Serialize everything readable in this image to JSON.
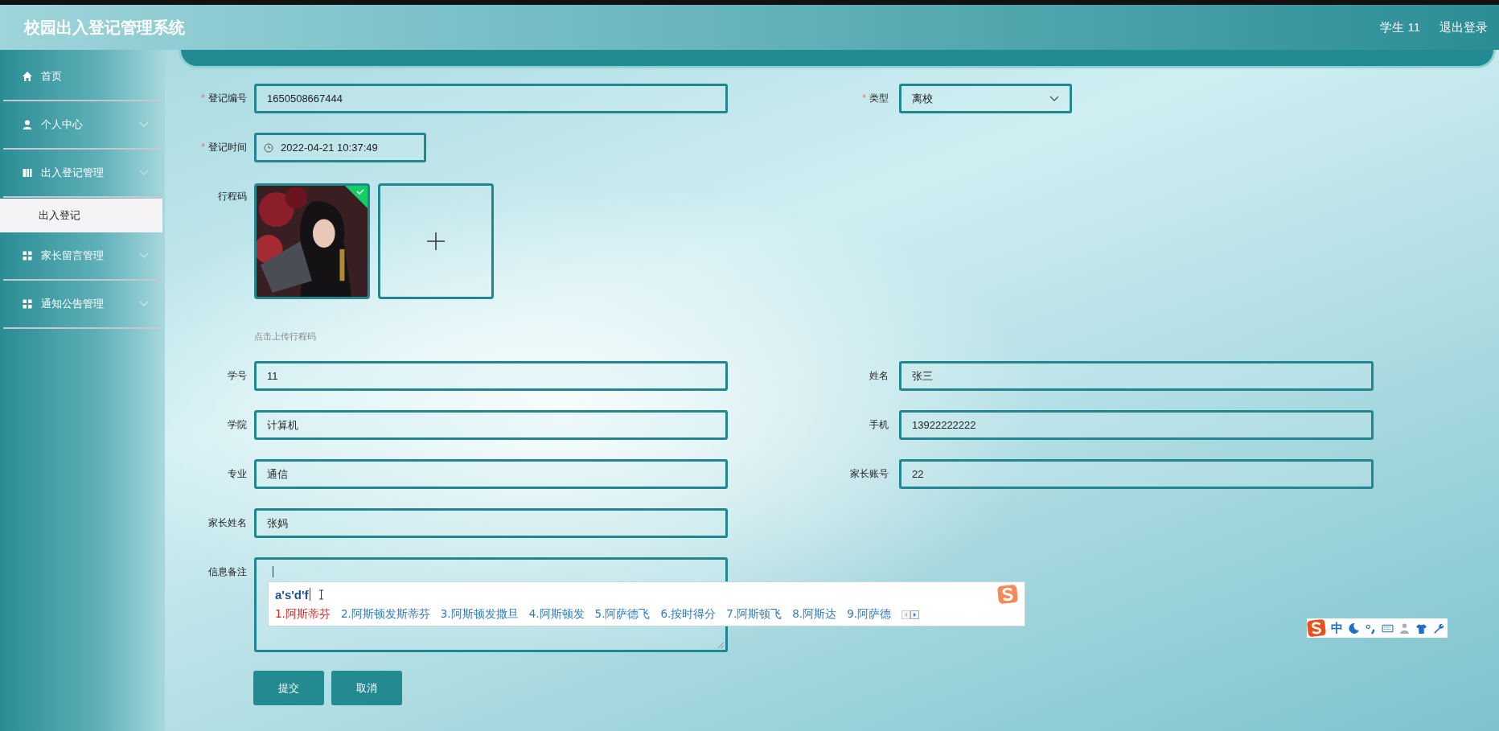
{
  "header": {
    "title": "校园出入登记管理系统",
    "user": "学生 11",
    "logout": "退出登录"
  },
  "sidebar": {
    "items": [
      {
        "label": "首页",
        "kind": "home"
      },
      {
        "label": "个人中心",
        "kind": "user",
        "expanded": false
      },
      {
        "label": "出入登记管理",
        "kind": "book",
        "expanded": true,
        "children": [
          {
            "label": "出入登记",
            "selected": true
          }
        ]
      },
      {
        "label": "家长留言管理",
        "kind": "grid",
        "expanded": false
      },
      {
        "label": "通知公告管理",
        "kind": "grid",
        "expanded": false
      }
    ]
  },
  "form": {
    "rows": [
      [
        {
          "kind": "text",
          "required_mark": "*",
          "label": "登记编号",
          "value": "1650508667444"
        },
        {
          "kind": "select",
          "required_mark": "*",
          "label": "类型",
          "value": "离校"
        }
      ],
      [
        {
          "kind": "datetime",
          "required_mark": "*",
          "label": "登记时间",
          "value": "2022-04-21 10:37:49"
        }
      ],
      [
        {
          "kind": "upload",
          "label": "行程码",
          "uploaded": true,
          "hint": "点击上传行程码"
        }
      ],
      [
        {
          "kind": "text",
          "label": "学号",
          "value": "11"
        },
        {
          "kind": "text",
          "label": "姓名",
          "value": "张三"
        }
      ],
      [
        {
          "kind": "text",
          "label": "学院",
          "value": "计算机"
        },
        {
          "kind": "text",
          "label": "手机",
          "value": "13922222222"
        }
      ],
      [
        {
          "kind": "text",
          "label": "专业",
          "value": "通信"
        },
        {
          "kind": "text",
          "label": "家长账号",
          "value": "22"
        }
      ],
      [
        {
          "kind": "text",
          "label": "家长姓名",
          "value": "张妈"
        }
      ],
      [
        {
          "kind": "textarea",
          "label": "信息备注"
        }
      ]
    ],
    "buttons": [
      "提交",
      "取消"
    ]
  },
  "ime": {
    "composition": "a's'd'f",
    "candidates": [
      {
        "text": "1.阿斯蒂芬",
        "selected": true
      },
      {
        "text": "2.阿斯顿发斯蒂芬",
        "selected": false
      },
      {
        "text": "3.阿斯顿发撒旦",
        "selected": false
      },
      {
        "text": "4.阿斯顿发",
        "selected": false
      },
      {
        "text": "5.阿萨德飞",
        "selected": false
      },
      {
        "text": "6.按时得分",
        "selected": false
      },
      {
        "text": "7.阿斯顿飞",
        "selected": false
      },
      {
        "text": "8.阿斯达",
        "selected": false
      },
      {
        "text": "9.阿萨德",
        "selected": false
      }
    ],
    "toolbar": {
      "mode": "中"
    }
  }
}
